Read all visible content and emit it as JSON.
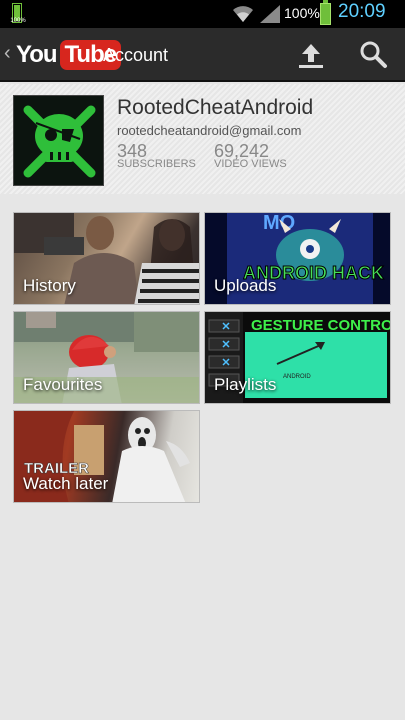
{
  "statusbar": {
    "left_battery_text": "100%",
    "battery_percent": "100%",
    "time": "20:09",
    "time_color": "#5fd0ff",
    "battery_color": "#6fbf3a"
  },
  "actionbar": {
    "logo_you": "You",
    "logo_tube": "Tube",
    "logo_red": "#d7261e",
    "title": "Account",
    "icons": [
      "back-chevron-icon",
      "upload-icon",
      "search-icon"
    ]
  },
  "profile": {
    "username": "RootedCheatAndroid",
    "email": "rootedcheatandroid@gmail.com",
    "subscribers_count": "348",
    "subscribers_label": "SUBSCRIBERS",
    "views_count": "69,242",
    "views_label": "VIDEO VIEWS"
  },
  "tiles": [
    {
      "label": "History"
    },
    {
      "label": "Uploads",
      "thumb_text": "ANDROID HACK",
      "thumb_top_text": "MO"
    },
    {
      "label": "Favourites"
    },
    {
      "label": "Playlists",
      "thumb_text": "GESTURE CONTROL",
      "thumb_sub_text": "ANDROID"
    },
    {
      "label": "Watch later",
      "thumb_text": "TRAILER"
    }
  ]
}
